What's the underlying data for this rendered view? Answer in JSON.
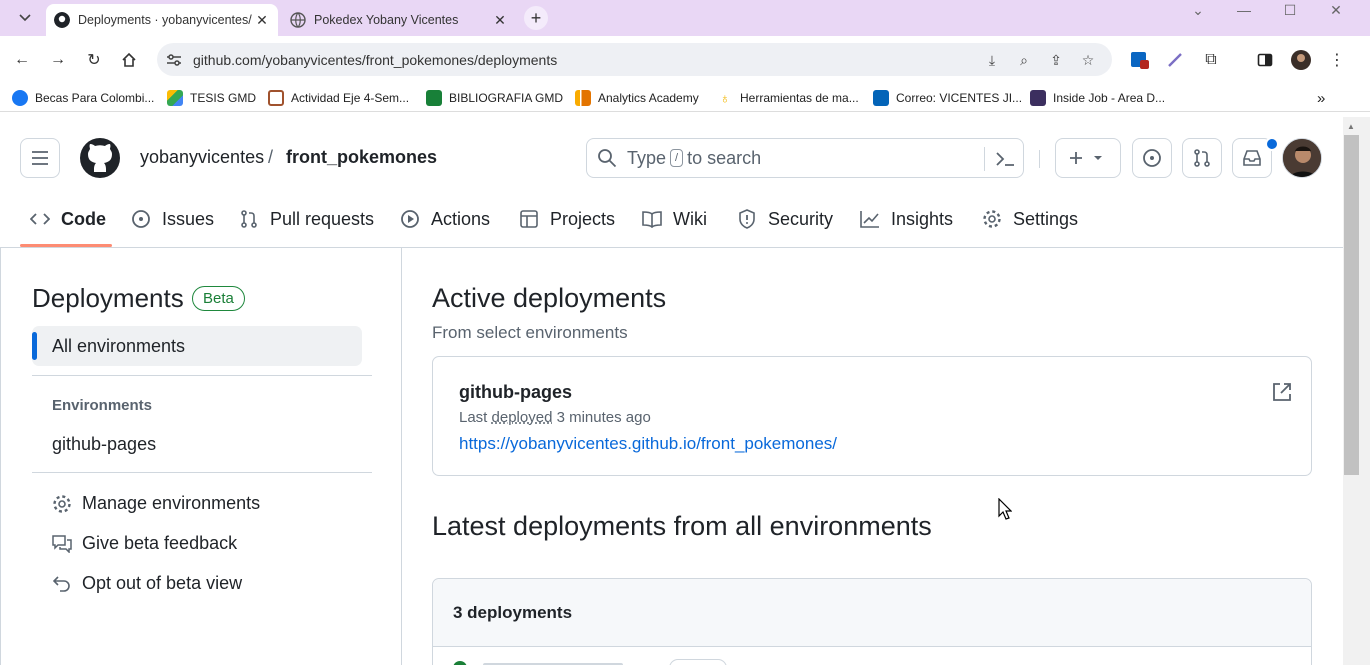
{
  "browser": {
    "tabs": [
      {
        "title": "Deployments · yobanyvicentes/f",
        "active": true
      },
      {
        "title": "Pokedex Yobany Vicentes",
        "active": false
      }
    ],
    "url": "github.com/yobanyvicentes/front_pokemones/deployments",
    "bookmarks": [
      "Becas Para Colombi...",
      "TESIS GMD",
      "Actividad Eje 4-Sem...",
      "BIBLIOGRAFIA GMD",
      "Analytics Academy",
      "Herramientas de ma...",
      "Correo: VICENTES JI...",
      "Inside Job - Area D..."
    ],
    "more_bookmarks": "»"
  },
  "header": {
    "owner": "yobanyvicentes",
    "separator": "/",
    "repo": "front_pokemones",
    "search_placeholder_before": "Type",
    "search_key": "/",
    "search_placeholder_after": "to search"
  },
  "repo_tabs": [
    "Code",
    "Issues",
    "Pull requests",
    "Actions",
    "Projects",
    "Wiki",
    "Security",
    "Insights",
    "Settings"
  ],
  "sidebar": {
    "title": "Deployments",
    "badge": "Beta",
    "selected": "All environments",
    "section_label": "Environments",
    "environments": [
      "github-pages"
    ],
    "links": [
      "Manage environments",
      "Give beta feedback",
      "Opt out of beta view"
    ]
  },
  "main": {
    "active_heading": "Active deployments",
    "active_sub": "From select environments",
    "card": {
      "env": "github-pages",
      "last": "Last",
      "deployed": "deployed",
      "ago": "3 minutes ago",
      "link": "https://yobanyvicentes.github.io/front_pokemones/"
    },
    "latest_heading": "Latest deployments from all environments",
    "count_label": "3 deployments"
  },
  "colors": {
    "tabstrip": "#e9d7f5",
    "link": "#0969da",
    "beta_green": "#1a7f37",
    "tab_underline": "#fd8c73",
    "notification_dot": "#0969da"
  }
}
